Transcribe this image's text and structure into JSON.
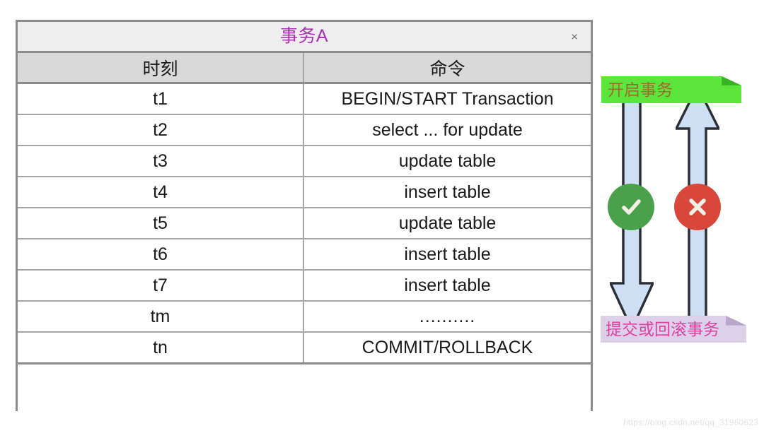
{
  "window": {
    "title": "事务A",
    "close_label": "×"
  },
  "table": {
    "headers": [
      "时刻",
      "命令"
    ],
    "rows": [
      {
        "time": "t1",
        "command": "BEGIN/START Transaction"
      },
      {
        "time": "t2",
        "command": "select ... for update"
      },
      {
        "time": "t3",
        "command": "update table"
      },
      {
        "time": "t4",
        "command": "insert table"
      },
      {
        "time": "t5",
        "command": "update table"
      },
      {
        "time": "t6",
        "command": "insert table"
      },
      {
        "time": "t7",
        "command": "insert table"
      },
      {
        "time": "tm",
        "command": ".........."
      },
      {
        "time": "tn",
        "command": "COMMIT/ROLLBACK"
      }
    ]
  },
  "flow": {
    "start_banner": {
      "label": "开启事务",
      "background": "#5ce63c",
      "text_color": "#9c6b2e"
    },
    "commit_banner": {
      "label": "提交或回滚事务",
      "background": "#ddd0ea",
      "text_color": "#e040a0"
    },
    "down_arrow": {
      "icon": "arrow-down-icon",
      "fill": "#cfe0f5",
      "stroke": "#2b2f36"
    },
    "up_arrow": {
      "icon": "arrow-up-icon",
      "fill": "#cfe0f5",
      "stroke": "#2b2f36"
    },
    "commit_badge": {
      "icon": "check-circle-icon",
      "color": "#4ba14b"
    },
    "rollback_badge": {
      "icon": "x-circle-icon",
      "color": "#d9463a"
    }
  },
  "watermark": {
    "text": "https://blog.csdn.net/qq_31960623"
  },
  "colors": {
    "title_purple": "#a832b0",
    "panel_border": "#8c8c8c",
    "header_gray": "#d9d9d9",
    "titlebar_gray": "#eeeeee"
  }
}
